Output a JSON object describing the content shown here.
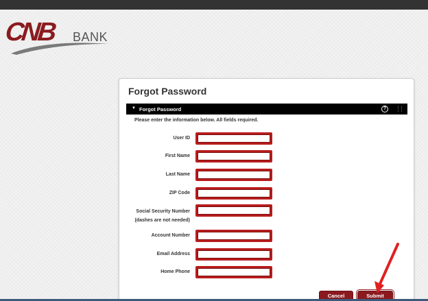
{
  "brand": {
    "logo_text": "CNB",
    "logo_suffix": "BANK",
    "primary_color": "#8b1a1f",
    "accent_grey": "#555555"
  },
  "form": {
    "title": "Forgot Password",
    "section_title": "Forgot Password",
    "help_glyph": "?",
    "instructions": "Please enter the information below. All fields required.",
    "fields": [
      {
        "label": "User ID",
        "value": ""
      },
      {
        "label": "First Name",
        "value": ""
      },
      {
        "label": "Last Name",
        "value": ""
      },
      {
        "label": "ZIP Code",
        "value": ""
      },
      {
        "label": "Social Security Number",
        "sublabel": "(dashes are not needed)",
        "value": ""
      },
      {
        "label": "Account Number",
        "value": ""
      },
      {
        "label": "Email Address",
        "value": ""
      },
      {
        "label": "Home Phone",
        "value": ""
      }
    ],
    "cancel_label": "Cancel",
    "submit_label": "Submit"
  },
  "icons": {
    "collapse": "caret-down-icon",
    "help": "help-icon",
    "arrow": "annotation-arrow"
  }
}
